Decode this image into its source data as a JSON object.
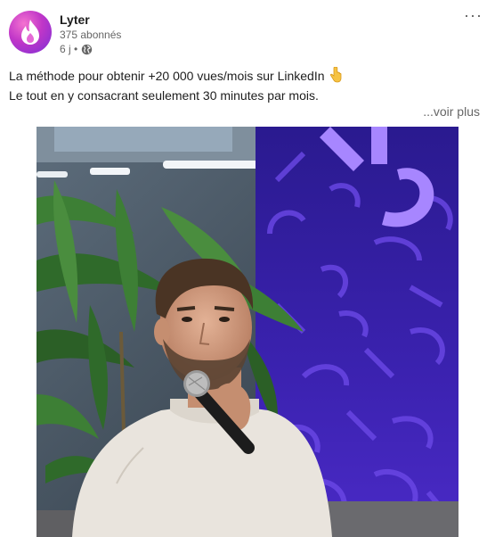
{
  "author": {
    "name": "Lyter",
    "followers": "375 abonnés",
    "time": "6 j •"
  },
  "icons": {
    "avatar": "lyter-flame-logo",
    "visibility": "globe-icon",
    "menu": "more-icon",
    "emoji": "backhand-index-pointing-down-emoji"
  },
  "post": {
    "line1": "La méthode pour obtenir +20 000 vues/mois sur LinkedIn",
    "line2": "Le tout en y consacrant seulement 30 minutes par mois.",
    "see_more": "...voir plus"
  },
  "colors": {
    "brand_gradient_start": "#f472d0",
    "brand_gradient_end": "#7b2fd6",
    "backdrop_purple": "#3b1fa8",
    "backdrop_accent": "#8a5cf5"
  }
}
